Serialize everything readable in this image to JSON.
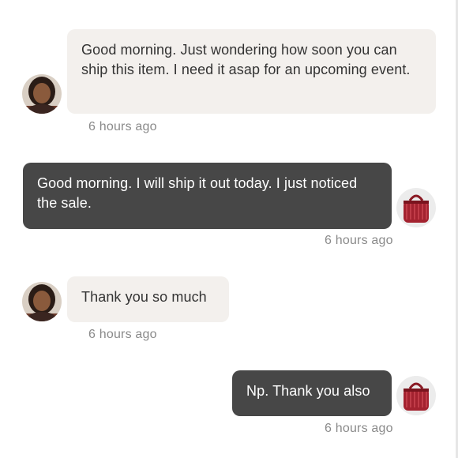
{
  "conversation": {
    "messages": [
      {
        "sender": "buyer",
        "text": "Good morning. Just wondering how soon you can ship this item. I need it asap for an upcoming event.",
        "time": "6 hours ago"
      },
      {
        "sender": "seller",
        "text": "Good morning. I will ship it out today. I just noticed the sale.",
        "time": "6 hours ago"
      },
      {
        "sender": "buyer",
        "text": "Thank you so much",
        "time": "6 hours ago"
      },
      {
        "sender": "seller",
        "text": "Np. Thank you also",
        "time": "6 hours ago"
      }
    ]
  },
  "avatars": {
    "buyer": {
      "icon": "woman-portrait-icon"
    },
    "seller": {
      "icon": "red-handbag-icon"
    }
  },
  "colors": {
    "incoming_bubble": "#f3f0ed",
    "outgoing_bubble": "#474747",
    "timestamp": "#8a8a8a"
  }
}
